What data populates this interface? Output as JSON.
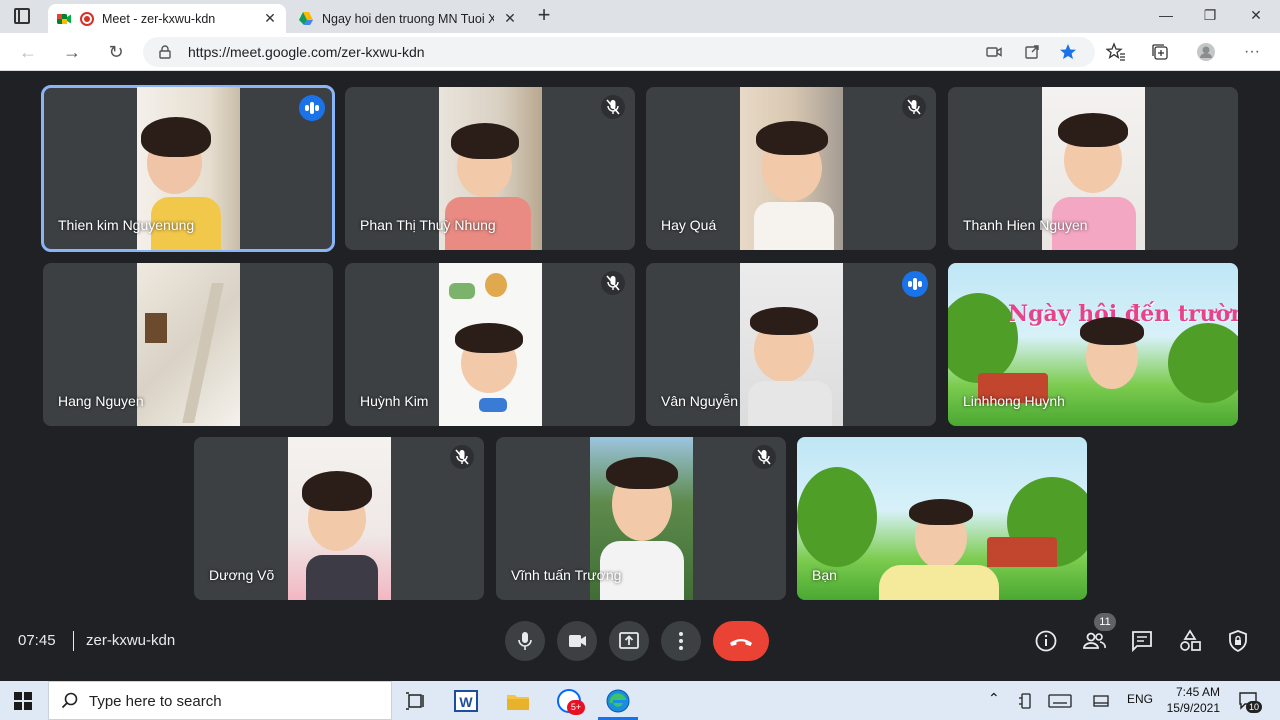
{
  "browser": {
    "tabs": [
      {
        "title": "Meet - zer-kxwu-kdn",
        "active": true
      },
      {
        "title": "Ngay hoi den truong MN Tuoi Xanh",
        "active": false
      }
    ],
    "url": "https://meet.google.com/zer-kxwu-kdn",
    "accent": "#1a73e8"
  },
  "meeting": {
    "time": "07:45",
    "code": "zer-kxwu-kdn",
    "participant_count": "11",
    "participants": [
      {
        "name": "Thien kim Nguyenung",
        "status": "speaking"
      },
      {
        "name": "Phan Thị Thuỳ Nhung",
        "status": "muted"
      },
      {
        "name": "Hay Quá",
        "status": "muted"
      },
      {
        "name": "Thanh Hien Nguyen",
        "status": "none"
      },
      {
        "name": "Hang Nguyen",
        "status": "none"
      },
      {
        "name": "Huỳnh Kim",
        "status": "muted"
      },
      {
        "name": "Vân Nguyễn",
        "status": "speaking"
      },
      {
        "name": "Linhhong Huynh",
        "status": "none"
      },
      {
        "name": "Dương Võ",
        "status": "muted"
      },
      {
        "name": "Vĩnh tuấn Trương",
        "status": "muted"
      },
      {
        "name": "Bạn",
        "status": "none"
      }
    ],
    "banner_title": "Ngày hội đến trường của bé"
  },
  "taskbar": {
    "search_placeholder": "Type here to search",
    "language": "ENG",
    "clock_time": "7:45 AM",
    "clock_date": "15/9/2021",
    "notification_count": "10",
    "zalo_badge": "5+"
  }
}
